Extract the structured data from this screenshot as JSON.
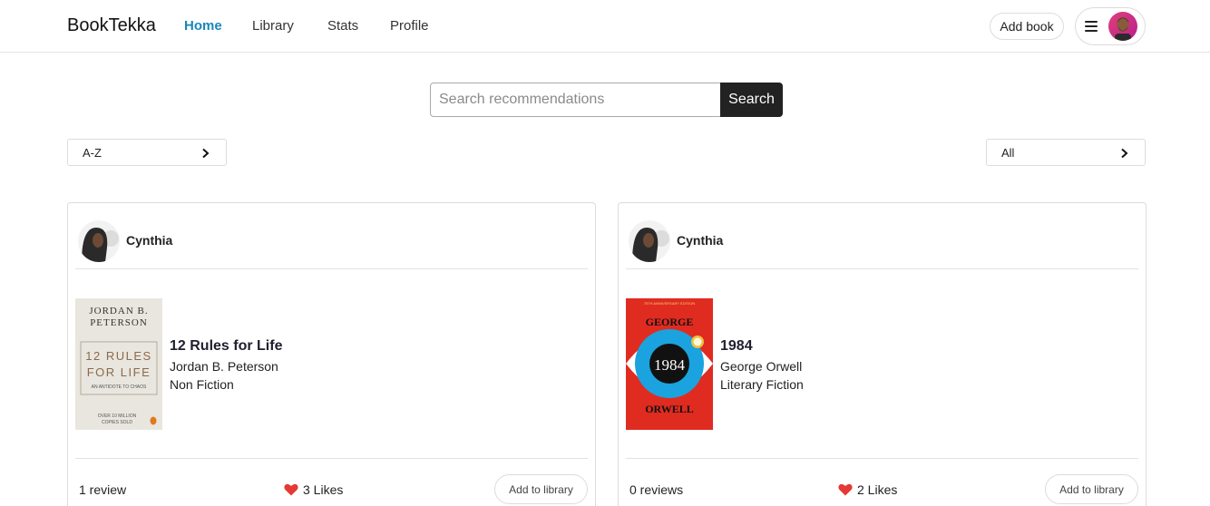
{
  "app": {
    "brand": "BookTekka"
  },
  "nav": [
    {
      "label": "Home",
      "active": true
    },
    {
      "label": "Library",
      "active": false
    },
    {
      "label": "Stats",
      "active": false
    },
    {
      "label": "Profile",
      "active": false
    }
  ],
  "header": {
    "add_book_label": "Add book",
    "menu_icon": "hamburger-icon"
  },
  "search": {
    "placeholder": "Search recommendations",
    "value": "",
    "button_label": "Search"
  },
  "filters": {
    "sort": {
      "value": "A-Z",
      "icon": "chevron-right-icon"
    },
    "category": {
      "value": "All",
      "icon": "chevron-right-icon"
    }
  },
  "cards": [
    {
      "user": "Cynthia",
      "book": {
        "title": "12 Rules for Life",
        "author": "Jordan B. Peterson",
        "genre": "Non Fiction",
        "cover": {
          "author_line1": "JORDAN B.",
          "author_line2": "PETERSON",
          "title_line1": "12 RULES",
          "title_line2": "FOR LIFE",
          "subtitle": "AN ANTIDOTE TO CHAOS",
          "footer_line1": "OVER 10 MILLION",
          "footer_line2": "COPIES SOLD"
        }
      },
      "reviews": "1 review",
      "likes": "3 Likes",
      "add_label": "Add to library"
    },
    {
      "user": "Cynthia",
      "book": {
        "title": "1984",
        "author": "George Orwell",
        "genre": "Literary Fiction",
        "cover": {
          "banner": "75TH ANNIVERSARY EDITION",
          "top": "GEORGE",
          "center": "1984",
          "bottom": "ORWELL"
        }
      },
      "reviews": "0 reviews",
      "likes": "2 Likes",
      "add_label": "Add to library"
    }
  ],
  "colors": {
    "accent": "#1a87b8",
    "heart": "#e53935",
    "search_button": "#222222",
    "cover_1984_bg": "#e02b20",
    "cover_1984_ring": "#1aa3de"
  }
}
